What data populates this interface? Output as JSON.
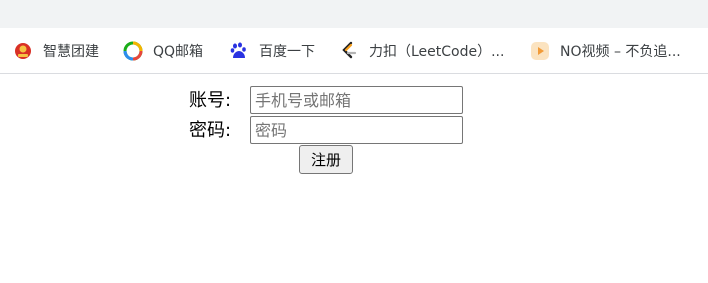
{
  "bookmarks": [
    {
      "label": "智慧团建",
      "icon": "youth-league-emblem-icon"
    },
    {
      "label": "QQ邮箱",
      "icon": "qq-mail-icon"
    },
    {
      "label": "百度一下",
      "icon": "baidu-paw-icon"
    },
    {
      "label": "力扣（LeetCode）...",
      "icon": "leetcode-icon"
    },
    {
      "label": "NO视频 – 不负追...",
      "icon": "video-play-icon"
    }
  ],
  "form": {
    "account_label": "账号:",
    "account_placeholder": "手机号或邮箱",
    "account_value": "",
    "password_label": "密码:",
    "password_placeholder": "密码",
    "password_value": "",
    "submit_label": "注册"
  },
  "colors": {
    "top_strip": "#f1f3f4",
    "bookmark_text": "#3c4043",
    "youth_league_red": "#d93025",
    "baidu_blue": "#2932e1",
    "leetcode_orange": "#f89f1b",
    "video_orange": "#f29b38"
  }
}
